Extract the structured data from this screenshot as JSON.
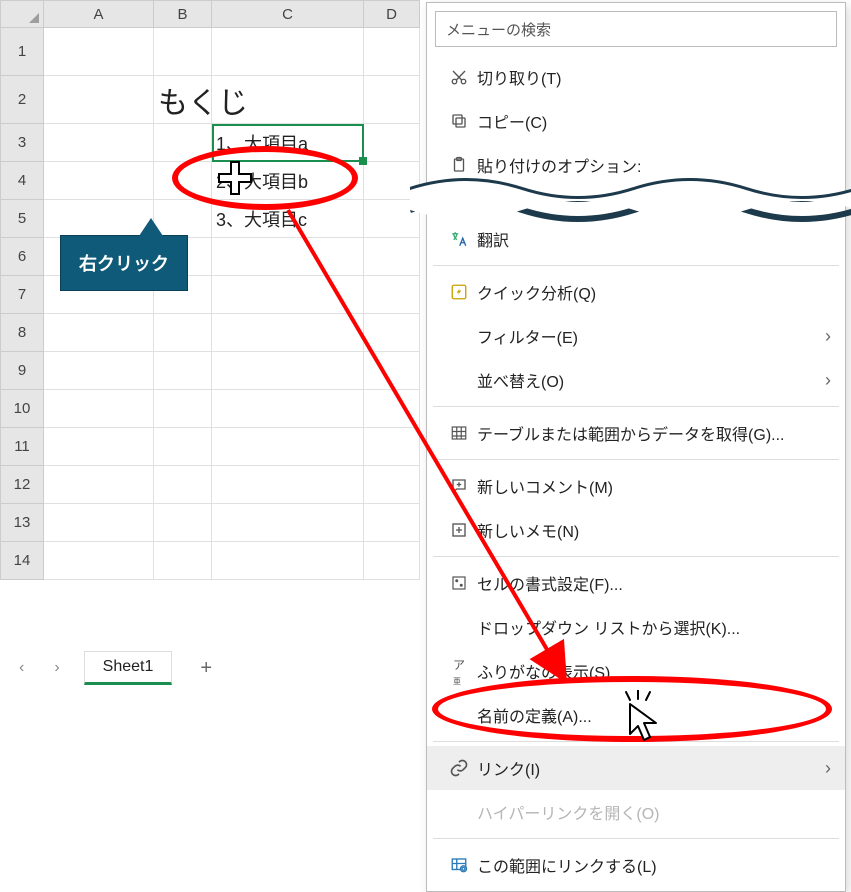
{
  "sheet": {
    "columns": [
      "A",
      "B",
      "C",
      "D"
    ],
    "rows": [
      "1",
      "2",
      "3",
      "4",
      "5",
      "6",
      "7",
      "8",
      "9",
      "10",
      "11",
      "12",
      "13",
      "14"
    ],
    "title": "もくじ",
    "items": [
      "1、大項目a",
      "2、大項目b",
      "3、大項目c"
    ],
    "tab": "Sheet1",
    "nav_prev": "‹",
    "nav_next": "›",
    "add": "+"
  },
  "callout": "右クリック",
  "menu": {
    "search_placeholder": "メニューの検索",
    "cut": "切り取り(T)",
    "copy": "コピー(C)",
    "paste_opts": "貼り付けのオプション:",
    "translate": "翻訳",
    "quick": "クイック分析(Q)",
    "filter": "フィルター(E)",
    "sort": "並べ替え(O)",
    "table": "テーブルまたは範囲からデータを取得(G)...",
    "comment": "新しいコメント(M)",
    "note": "新しいメモ(N)",
    "format": "セルの書式設定(F)...",
    "dropdown": "ドロップダウン リストから選択(K)...",
    "furigana": "ふりがなの表示(S)",
    "name": "名前の定義(A)...",
    "link": "リンク(I)",
    "openlink": "ハイパーリンクを開く(O)",
    "linkrange": "この範囲にリンクする(L)"
  }
}
